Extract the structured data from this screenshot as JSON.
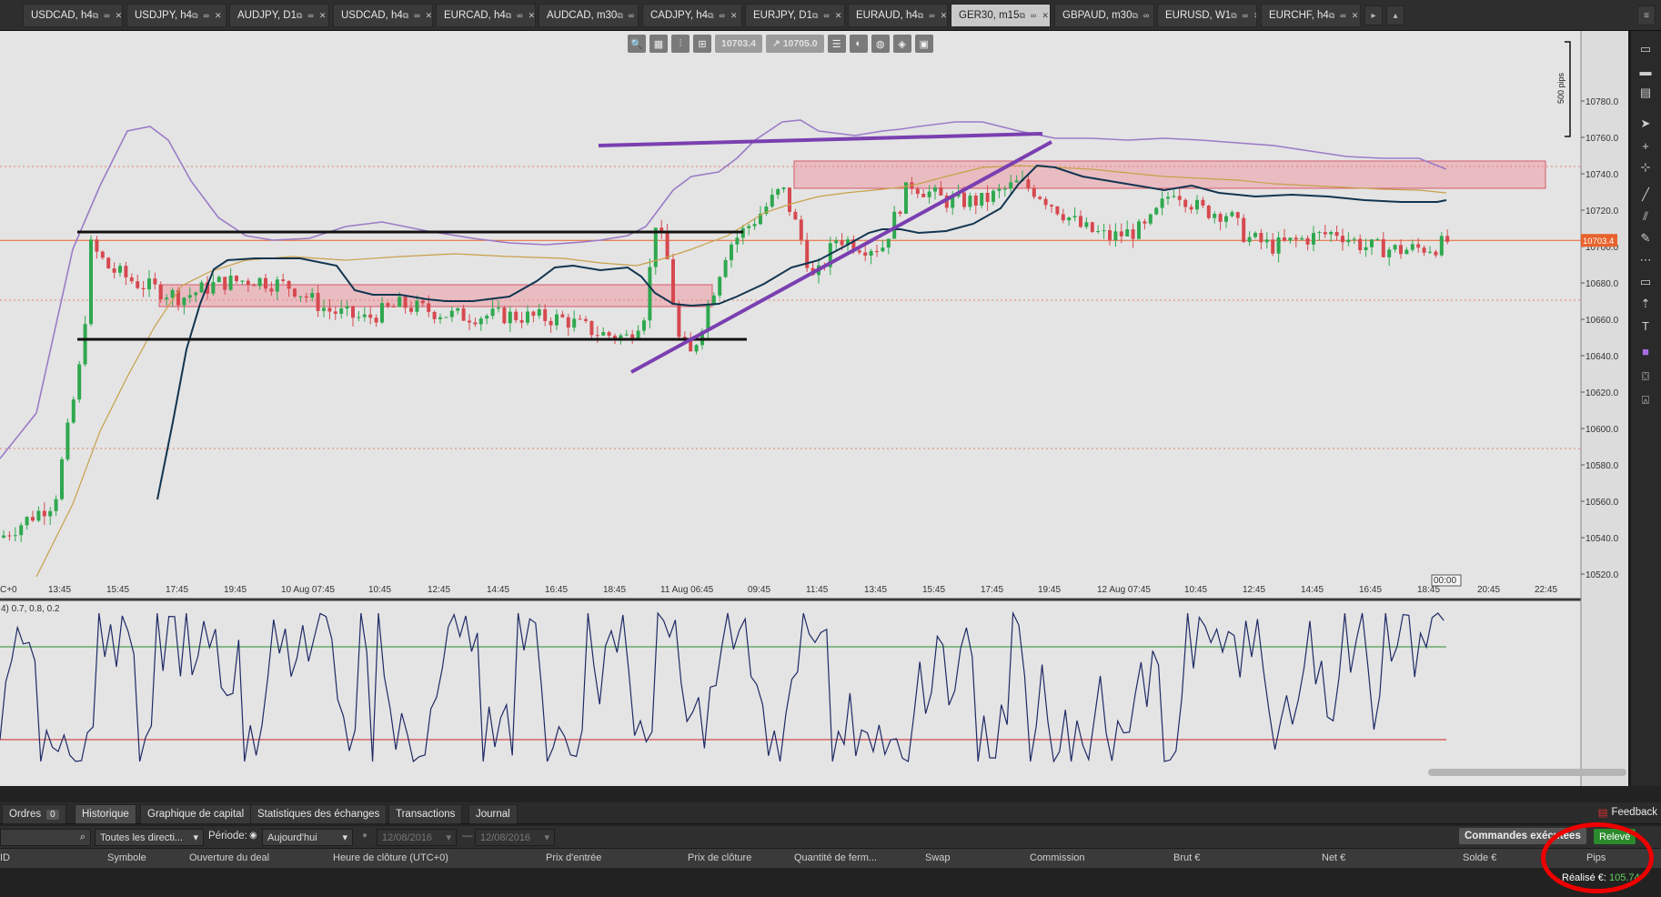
{
  "tabs": [
    {
      "label": "USDCAD, h4"
    },
    {
      "label": "USDJPY, h4"
    },
    {
      "label": "AUDJPY, D1"
    },
    {
      "label": "USDCAD, h4"
    },
    {
      "label": "EURCAD, h4"
    },
    {
      "label": "AUDCAD, m30"
    },
    {
      "label": "CADJPY, h4"
    },
    {
      "label": "EURJPY, D1"
    },
    {
      "label": "EURAUD, h4"
    },
    {
      "label": "GER30, m15"
    },
    {
      "label": "GBPAUD, m30"
    },
    {
      "label": "EURUSD, W1"
    },
    {
      "label": "EURCHF, h4"
    }
  ],
  "active_tab": 9,
  "toolbar": {
    "bid": "10703.4",
    "ask": "10705.0"
  },
  "price_scale": {
    "pips_label": "500 pips",
    "ticks": [
      "10780.0",
      "10760.0",
      "10740.0",
      "10720.0",
      "10700.0",
      "10680.0",
      "10660.0",
      "10640.0",
      "10620.0",
      "10600.0",
      "10580.0",
      "10560.0",
      "10540.0",
      "10520.0"
    ],
    "current_price": "10703.4"
  },
  "time_axis": {
    "labels": [
      "C+0",
      "13:45",
      "15:45",
      "17:45",
      "19:45",
      "10 Aug 07:45",
      "10:45",
      "12:45",
      "14:45",
      "16:45",
      "18:45",
      "11 Aug 06:45",
      "09:45",
      "11:45",
      "13:45",
      "15:45",
      "17:45",
      "19:45",
      "12 Aug 07:45",
      "10:45",
      "12:45",
      "14:45",
      "16:45",
      "18:45",
      "00:00",
      "20:45",
      "22:45"
    ]
  },
  "oscillator": {
    "label": "4) 0.7, 0.8, 0.2"
  },
  "colors": {
    "up": "#2fa84f",
    "down": "#d6494f",
    "bollinger": "#9a7bc6",
    "ma": "#c8a04a",
    "support": "#123550",
    "trend": "#7a3fb0",
    "zone": "rgba(240,140,150,0.45)",
    "current": "#e8622c"
  },
  "bottom": {
    "tabs": [
      {
        "label": "Ordres",
        "badge": "0"
      },
      {
        "label": "Historique"
      },
      {
        "label": "Graphique de capital"
      },
      {
        "label": "Statistiques des échanges"
      },
      {
        "label": "Transactions"
      },
      {
        "label": "Journal"
      }
    ],
    "active_tab": 1,
    "feedback": "Feedback",
    "filters": {
      "direction": "Toutes les directi...",
      "periode_label": "Période:",
      "period_value": "Aujourd'hui",
      "date_from": "12/08/2016",
      "date_to": "12/08/2016"
    },
    "commandes": "Commandes exécutées",
    "releve": "Relevé",
    "columns": [
      "ID",
      "Symbole",
      "Ouverture du deal",
      "Heure de clôture (UTC+0)",
      "Prix d'entrée",
      "Prix de clôture",
      "Quantité de ferm...",
      "Swap",
      "Commission",
      "Brut €",
      "Net €",
      "Solde €",
      "Pips"
    ],
    "realise_label": "Réalisé €:",
    "realise_value": "105.74"
  }
}
